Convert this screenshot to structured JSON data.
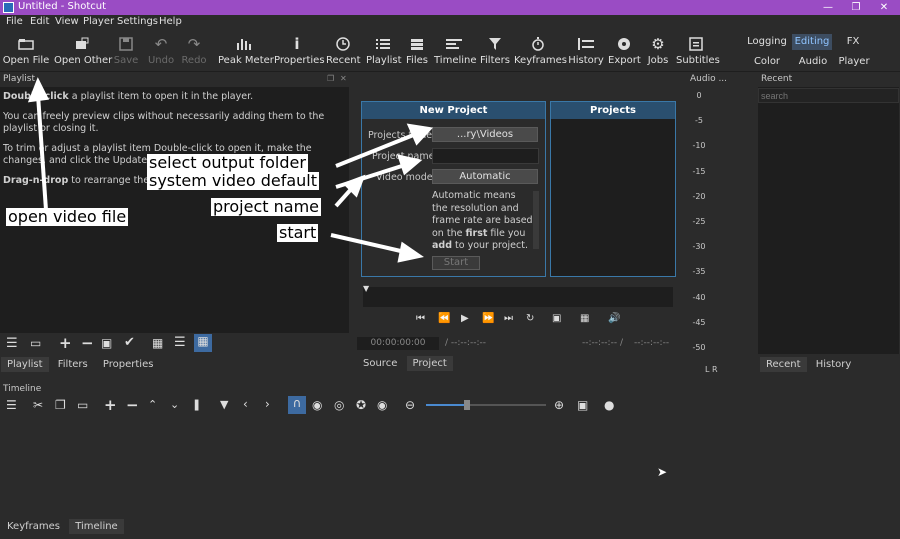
{
  "title_bar": {
    "title": "Untitled - Shotcut"
  },
  "menu": [
    "File",
    "Edit",
    "View",
    "Player",
    "Settings",
    "Help"
  ],
  "toolbar": [
    {
      "label": "Open File",
      "icon": "folder-icon"
    },
    {
      "label": "Open Other",
      "icon": "open-other-icon"
    },
    {
      "label": "Save",
      "icon": "save-icon"
    },
    {
      "label": "Undo",
      "icon": "undo-icon"
    },
    {
      "label": "Redo",
      "icon": "redo-icon"
    },
    {
      "label": "Peak Meter",
      "icon": "peak-meter-icon"
    },
    {
      "label": "Properties",
      "icon": "info-icon"
    },
    {
      "label": "Recent",
      "icon": "clock-icon"
    },
    {
      "label": "Playlist",
      "icon": "list-icon"
    },
    {
      "label": "Files",
      "icon": "files-icon"
    },
    {
      "label": "Timeline",
      "icon": "timeline-icon"
    },
    {
      "label": "Filters",
      "icon": "filter-icon"
    },
    {
      "label": "Keyframes",
      "icon": "stopwatch-icon"
    },
    {
      "label": "History",
      "icon": "history-icon"
    },
    {
      "label": "Export",
      "icon": "export-icon"
    },
    {
      "label": "Jobs",
      "icon": "gear-icon"
    },
    {
      "label": "Subtitles",
      "icon": "subtitles-icon"
    }
  ],
  "layouts": {
    "row1": [
      "Logging",
      "Editing",
      "FX"
    ],
    "row2": [
      "Color",
      "Audio",
      "Player"
    ],
    "selected": "Editing"
  },
  "playlist": {
    "title": "Playlist",
    "help": [
      {
        "bold": "Double-click",
        "text": " a playlist item to open it in the player."
      },
      {
        "bold": "",
        "text": "You can freely preview clips without necessarily adding them to the playlist or closing it."
      },
      {
        "bold": "",
        "text": "To trim or adjust a playlist item Double-click to open it, make the changes, and click the Update icon."
      },
      {
        "bold": "Drag-n-drop",
        "text": " to rearrange the items."
      }
    ],
    "tabs": [
      "Playlist",
      "Filters",
      "Properties"
    ]
  },
  "new_project": {
    "header": "New Project",
    "projects_folder_label": "Projects folder",
    "projects_folder_value": "...ry\\Videos",
    "project_name_label": "Project name",
    "video_mode_label": "Video mode",
    "video_mode_value": "Automatic",
    "desc_parts": [
      "Automatic means the resolution and frame rate are based on the ",
      "first",
      " file you ",
      "add",
      " to your project. If the first"
    ],
    "start_label": "Start"
  },
  "projects": {
    "header": "Projects"
  },
  "player": {
    "timecode": "00:00:00:00",
    "in_out": "--:--:--:--",
    "in_out2": "--:--:--:-- /",
    "in_out3": "--:--:--:--",
    "tabs": [
      "Source",
      "Project"
    ]
  },
  "audio": {
    "title": "Audio ...",
    "levels": [
      "0",
      "-5",
      "-10",
      "-15",
      "-20",
      "-25",
      "-30",
      "-35",
      "-40",
      "-45",
      "-50"
    ],
    "channels": "L R"
  },
  "recent": {
    "title": "Recent",
    "search_placeholder": "search",
    "tabs": [
      "Recent",
      "History"
    ]
  },
  "timeline": {
    "title": "Timeline",
    "tabs": [
      "Keyframes",
      "Timeline"
    ]
  },
  "annotations": [
    "open video file",
    "select output folder",
    "system video default",
    "project name",
    "start"
  ]
}
